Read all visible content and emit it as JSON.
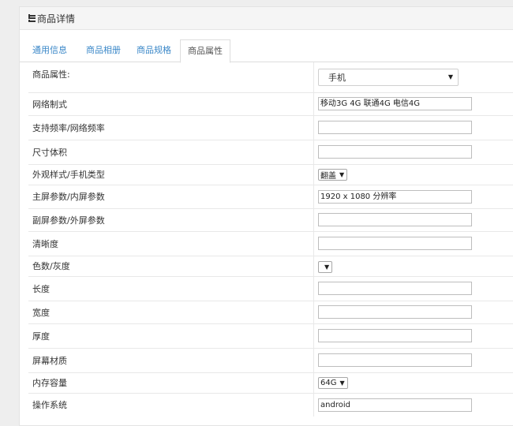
{
  "panel": {
    "title": "商品详情",
    "title_icon": "list-icon"
  },
  "tabs": [
    {
      "label": "通用信息",
      "active": false
    },
    {
      "label": "商品相册",
      "active": false
    },
    {
      "label": "商品规格",
      "active": false
    },
    {
      "label": "商品属性",
      "active": true
    }
  ],
  "attributes": {
    "type_label": "商品属性:",
    "type_value": "手机",
    "rows": [
      {
        "label": "网络制式",
        "value": "移动3G 4G 联通4G 电信4G"
      },
      {
        "label": "支持频率/网络频率",
        "value": ""
      },
      {
        "label": "尺寸体积",
        "value": ""
      },
      {
        "label": "外观样式/手机类型",
        "select": "翻盖"
      },
      {
        "label": "主屏参数/内屏参数",
        "value": "1920 x 1080 分辨率"
      },
      {
        "label": "副屏参数/外屏参数",
        "value": ""
      },
      {
        "label": "清晰度",
        "value": ""
      },
      {
        "label": "色数/灰度",
        "select": ""
      },
      {
        "label": "长度",
        "value": ""
      },
      {
        "label": "宽度",
        "value": ""
      },
      {
        "label": "厚度",
        "value": ""
      },
      {
        "label": "屏幕材质",
        "value": ""
      },
      {
        "label": "内存容量",
        "select": "64G"
      },
      {
        "label": "操作系统",
        "value": "android"
      }
    ]
  }
}
